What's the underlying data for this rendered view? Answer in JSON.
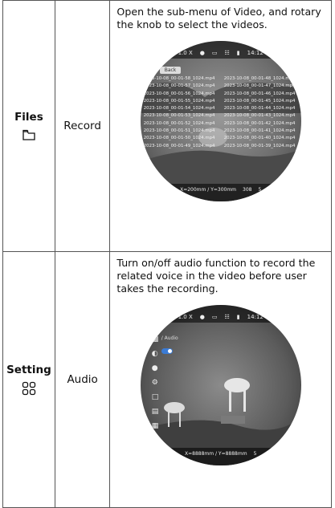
{
  "rows": [
    {
      "category": "Files",
      "category_icon": "folder-icon",
      "item": "Record",
      "description": "Open the sub-menu of Video, and rotary the knob to select the videos.",
      "screen": {
        "top_bar": {
          "zoom": "1.0 X",
          "time": "14:12"
        },
        "back_label": "Back",
        "files": [
          "2023-10-08_00-01-58_1024.mp4",
          "2023-10-08_00-01-48_1024.mp4",
          "2023-10-08_00-01-57_1024.mp4",
          "2023-10-08_00-01-47_1024.mp4",
          "2023-10-08_00-01-56_1024.mp4",
          "2023-10-08_00-01-46_1024.mp4",
          "2023-10-08_00-01-55_1024.mp4",
          "2023-10-08_00-01-45_1024.mp4",
          "2023-10-08_00-01-54_1024.mp4",
          "2023-10-08_00-01-44_1024.mp4",
          "2023-10-08_00-01-53_1024.mp4",
          "2023-10-08_00-01-43_1024.mp4",
          "2023-10-08_00-01-52_1024.mp4",
          "2023-10-08_00-01-42_1024.mp4",
          "2023-10-08_00-01-51_1024.mp4",
          "2023-10-08_00-01-41_1024.mp4",
          "2023-10-08_00-01-50_1024.mp4",
          "2023-10-08_00-01-40_1024.mp4",
          "2023-10-08_00-01-49_1024.mp4",
          "2023-10-08_00-01-39_1024.mp4"
        ],
        "bottom_bar": {
          "coords": "X=200mm / Y=300mm",
          "count": "308",
          "level": "5"
        }
      }
    },
    {
      "category": "Setting",
      "category_icon": "grid-icon",
      "item": "Audio",
      "description": "Turn on/off audio function to record the related voice in the video before user takes the recording.",
      "screen": {
        "top_bar": {
          "zoom": "1.0 X",
          "time": "14:12"
        },
        "menu_label": "/ Audio",
        "bottom_bar": {
          "coords": "X=8888mm / Y=8888mm",
          "level": "5"
        }
      }
    }
  ]
}
